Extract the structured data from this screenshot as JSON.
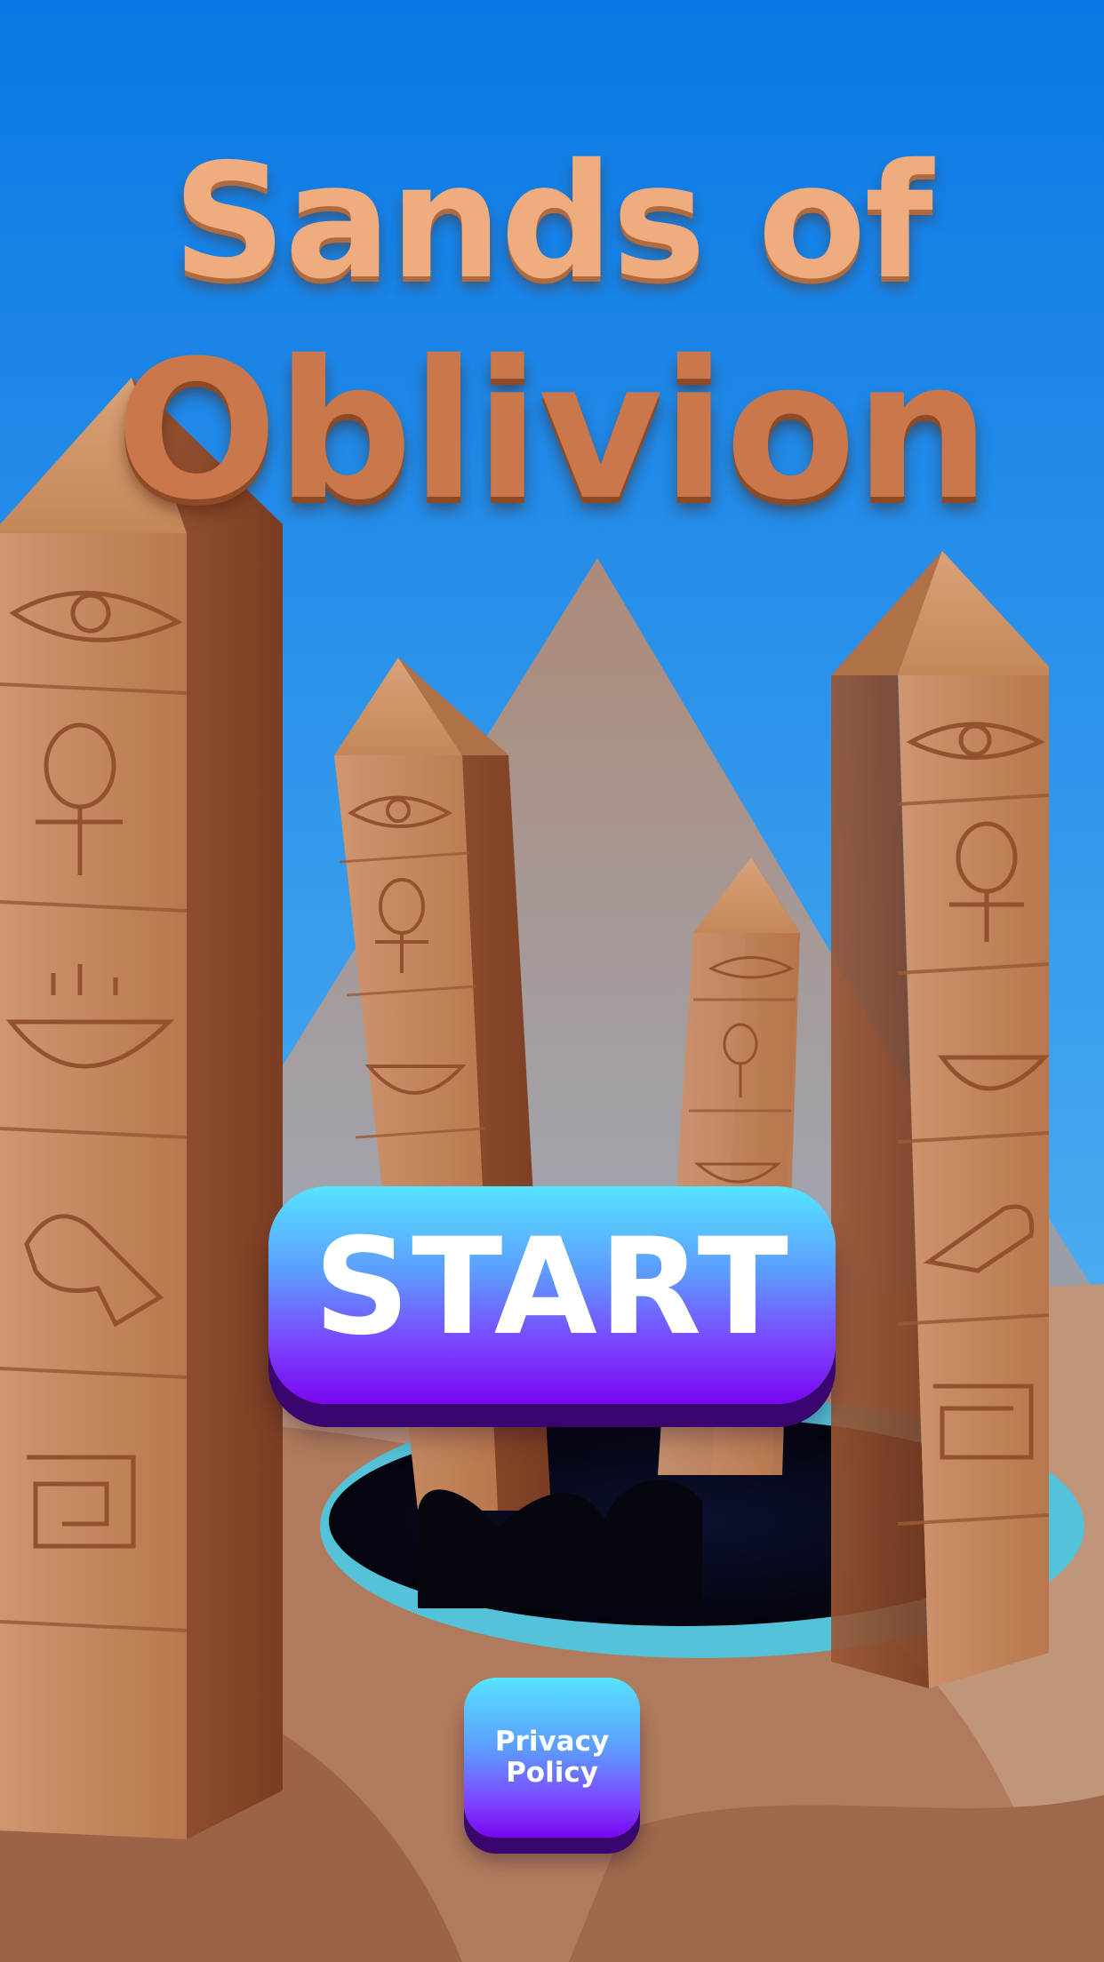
{
  "title": {
    "line1": "Sands of",
    "line2": "Oblivion"
  },
  "start_button": {
    "label": "START"
  },
  "privacy_button": {
    "line1": "Privacy",
    "line2": "Policy"
  },
  "colors": {
    "sky_top": "#0a78e4",
    "sky_bottom": "#7ac8f5",
    "sand": "#b7876a",
    "pyramid": "#b1907e",
    "portal_ring": "#54c2d8",
    "portal_hole": "#050714",
    "stone": "#c98d63",
    "title_light": "#eeac7f",
    "title_dark": "#c9774b",
    "button_top": "#56e3ff",
    "button_bottom": "#7a05f0"
  },
  "icons": [
    "eye-of-horus-icon",
    "ankh-icon",
    "bowl-glyph-icon",
    "bird-glyph-icon",
    "spiral-glyph-icon"
  ]
}
